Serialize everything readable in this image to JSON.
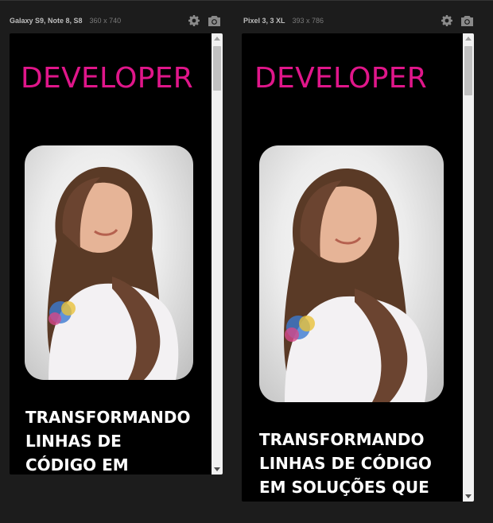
{
  "devices": [
    {
      "name": "Galaxy S9, Note 8, S8",
      "size": "360 x 740",
      "heading": "DEVELOPER",
      "tagline_lines": [
        "TRANSFORMANDO",
        "LINHAS DE",
        "CÓDIGO EM"
      ],
      "scroll_position": 0.0
    },
    {
      "name": "Pixel 3, 3 XL",
      "size": "393 x 786",
      "heading": "DEVELOPER",
      "tagline_lines": [
        "TRANSFORMANDO",
        "LINHAS DE CÓDIGO",
        "EM SOLUÇÕES QUE"
      ],
      "scroll_position": 0.0
    }
  ],
  "icons": {
    "settings": "gear-icon",
    "screenshot": "camera-icon"
  },
  "colors": {
    "accent": "#e0168a",
    "background": "#1c1c1c",
    "screen": "#000000",
    "text": "#ffffff"
  }
}
